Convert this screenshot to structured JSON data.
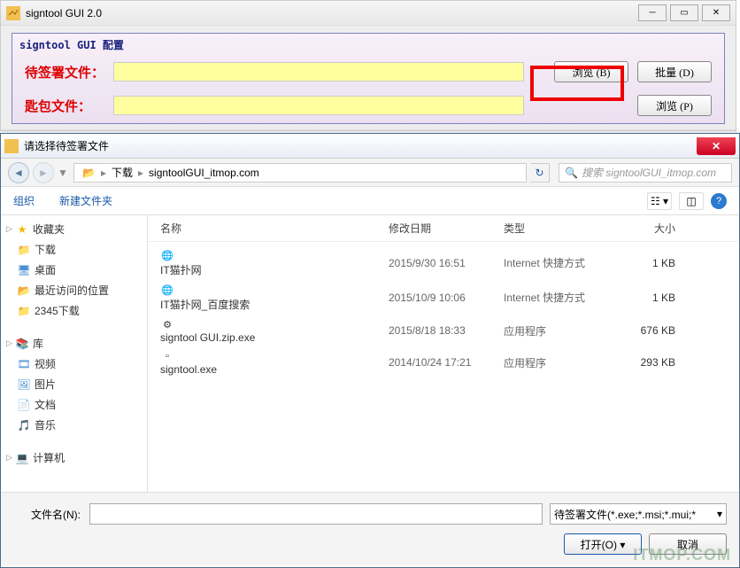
{
  "parent": {
    "title": "signtool GUI 2.0",
    "config_header": "signtool GUI 配置",
    "row1_label": "待签署文件：",
    "row2_label": "匙包文件：",
    "browse_b": "浏览 (B)",
    "batch_d": "批量 (D)",
    "browse_p": "浏览 (P)"
  },
  "dialog": {
    "title": "请选择待签署文件",
    "breadcrumb": {
      "p1": "下载",
      "p2": "signtoolGUI_itmop.com"
    },
    "search_placeholder": "搜索 signtoolGUI_itmop.com",
    "toolbar": {
      "organize": "组织",
      "new_folder": "新建文件夹"
    },
    "columns": {
      "name": "名称",
      "date": "修改日期",
      "type": "类型",
      "size": "大小"
    },
    "sidebar": {
      "favorites": "收藏夹",
      "items_fav": [
        "下载",
        "桌面",
        "最近访问的位置",
        "2345下载"
      ],
      "libraries": "库",
      "items_lib": [
        "视频",
        "图片",
        "文档",
        "音乐"
      ],
      "computer": "计算机"
    },
    "files": [
      {
        "name": "IT猫扑网",
        "date": "2015/9/30 16:51",
        "type": "Internet 快捷方式",
        "size": "1 KB",
        "icon": "ie"
      },
      {
        "name": "IT猫扑网_百度搜索",
        "date": "2015/10/9 10:06",
        "type": "Internet 快捷方式",
        "size": "1 KB",
        "icon": "ie"
      },
      {
        "name": "signtool GUI.zip.exe",
        "date": "2015/8/18 18:33",
        "type": "应用程序",
        "size": "676 KB",
        "icon": "exe"
      },
      {
        "name": "signtool.exe",
        "date": "2014/10/24 17:21",
        "type": "应用程序",
        "size": "293 KB",
        "icon": "exe2"
      }
    ],
    "footer": {
      "filename_label": "文件名(N):",
      "filter": "待签署文件(*.exe;*.msi;*.mui;*",
      "open": "打开(O)",
      "cancel": "取消"
    }
  },
  "watermark": "ITMOP.COM"
}
